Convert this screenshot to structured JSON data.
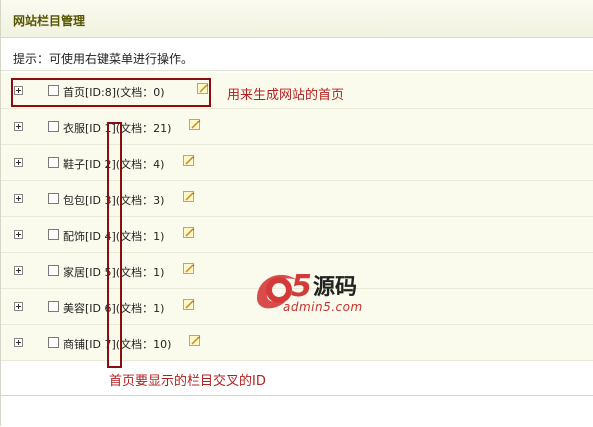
{
  "page": {
    "title": "网站栏目管理",
    "hint": "提示：可使用右键菜单进行操作。"
  },
  "rows": [
    {
      "label": "首页[ID:8](文档：0)"
    },
    {
      "label": "衣服[ID 1](文档：21)"
    },
    {
      "label": "鞋子[ID 2](文档：4)"
    },
    {
      "label": "包包[ID 3](文档：3)"
    },
    {
      "label": "配饰[ID 4](文档：1)"
    },
    {
      "label": "家居[ID 5](文档：1)"
    },
    {
      "label": "美容[ID 6](文档：1)"
    },
    {
      "label": "商铺[ID 7](文档：10)"
    }
  ],
  "annotations": {
    "homepage_note": "用来生成网站的首页",
    "id_note": "首页要显示的栏目交叉的ID"
  },
  "watermark": {
    "logo": "a5源码",
    "domain": "admin5.com"
  },
  "colors": {
    "accent": "#8a0e0e",
    "annotation": "#b42020",
    "row_bg": "#fafbec",
    "title": "#565600"
  }
}
